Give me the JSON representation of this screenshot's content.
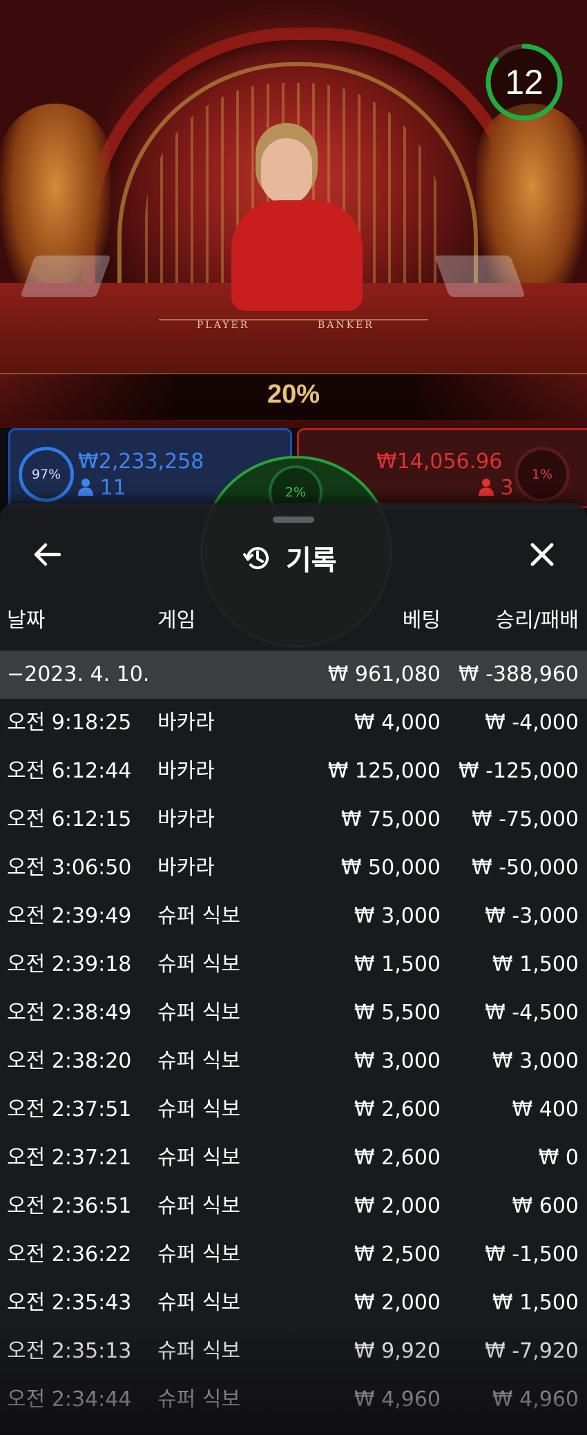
{
  "video": {
    "table_labels": {
      "player": "PLAYER",
      "banker": "BANKER"
    }
  },
  "timer": {
    "seconds": "12",
    "accent": "#1fae3d"
  },
  "payout": {
    "label": "20%"
  },
  "bets": {
    "player": {
      "percent": "97%",
      "amount": "₩2,233,258",
      "players": "11",
      "color": "#2d7be4"
    },
    "banker": {
      "percent": "1%",
      "amount": "₩14,056.96",
      "players": "3",
      "color": "#e03030"
    },
    "tie": {
      "percent": "2%",
      "color": "#27a33a"
    }
  },
  "history": {
    "title": "기록",
    "icons": {
      "back": "arrow-left-icon",
      "title": "history-icon",
      "close": "close-icon"
    },
    "columns": {
      "date": "날짜",
      "game": "게임",
      "bet": "베팅",
      "win_loss": "승리/패배"
    },
    "group": {
      "date": "−2023. 4. 10.",
      "bet": "₩ 961,080",
      "win_loss": "₩ -388,960"
    },
    "rows": [
      {
        "time": "오전 9:18:25",
        "game": "바카라",
        "bet": "₩ 4,000",
        "win_loss": "₩ -4,000"
      },
      {
        "time": "오전 6:12:44",
        "game": "바카라",
        "bet": "₩ 125,000",
        "win_loss": "₩ -125,000"
      },
      {
        "time": "오전 6:12:15",
        "game": "바카라",
        "bet": "₩ 75,000",
        "win_loss": "₩ -75,000"
      },
      {
        "time": "오전 3:06:50",
        "game": "바카라",
        "bet": "₩ 50,000",
        "win_loss": "₩ -50,000"
      },
      {
        "time": "오전 2:39:49",
        "game": "슈퍼 식보",
        "bet": "₩ 3,000",
        "win_loss": "₩ -3,000"
      },
      {
        "time": "오전 2:39:18",
        "game": "슈퍼 식보",
        "bet": "₩ 1,500",
        "win_loss": "₩ 1,500"
      },
      {
        "time": "오전 2:38:49",
        "game": "슈퍼 식보",
        "bet": "₩ 5,500",
        "win_loss": "₩ -4,500"
      },
      {
        "time": "오전 2:38:20",
        "game": "슈퍼 식보",
        "bet": "₩ 3,000",
        "win_loss": "₩ 3,000"
      },
      {
        "time": "오전 2:37:51",
        "game": "슈퍼 식보",
        "bet": "₩ 2,600",
        "win_loss": "₩ 400"
      },
      {
        "time": "오전 2:37:21",
        "game": "슈퍼 식보",
        "bet": "₩ 2,600",
        "win_loss": "₩ 0"
      },
      {
        "time": "오전 2:36:51",
        "game": "슈퍼 식보",
        "bet": "₩ 2,000",
        "win_loss": "₩ 600"
      },
      {
        "time": "오전 2:36:22",
        "game": "슈퍼 식보",
        "bet": "₩ 2,500",
        "win_loss": "₩ -1,500"
      },
      {
        "time": "오전 2:35:43",
        "game": "슈퍼 식보",
        "bet": "₩ 2,000",
        "win_loss": "₩ 1,500"
      },
      {
        "time": "오전 2:35:13",
        "game": "슈퍼 식보",
        "bet": "₩ 9,920",
        "win_loss": "₩ -7,920"
      },
      {
        "time": "오전 2:34:44",
        "game": "슈퍼 식보",
        "bet": "₩ 4,960",
        "win_loss": "₩ 4,960"
      }
    ]
  }
}
